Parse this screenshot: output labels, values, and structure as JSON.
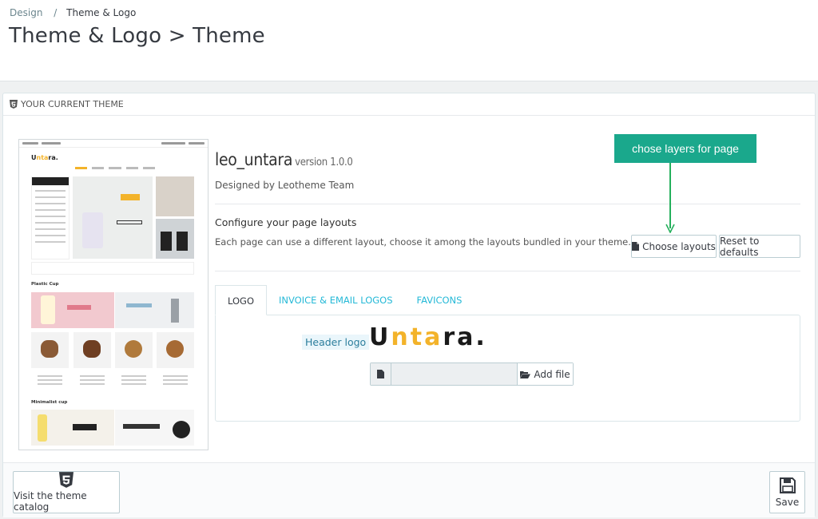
{
  "breadcrumb": {
    "parent": "Design",
    "separator": "/",
    "current": "Theme & Logo"
  },
  "page_title": "Theme & Logo > Theme",
  "panel": {
    "heading": "YOUR CURRENT THEME"
  },
  "theme": {
    "name": "leo_untara",
    "version": "version 1.0.0",
    "designed_by": "Designed by Leotheme Team"
  },
  "layouts": {
    "title": "Configure your page layouts",
    "description": "Each page can use a different layout, choose it among the layouts bundled in your theme.",
    "choose_label": "Choose layouts",
    "reset_label": "Reset to defaults"
  },
  "annotation": {
    "text": "chose layers for page",
    "color": "#1aa88c"
  },
  "tabs": [
    {
      "label": "LOGO",
      "active": true
    },
    {
      "label": "INVOICE & EMAIL LOGOS",
      "active": false
    },
    {
      "label": "FAVICONS",
      "active": false
    }
  ],
  "logo_tab": {
    "header_logo_label": "Header logo",
    "logo_image_text": {
      "part1": "U",
      "part2": "nta",
      "part3": "ra."
    },
    "add_file_label": "Add file"
  },
  "preview": {
    "brand": {
      "part1": "U",
      "part2": "nta",
      "part3": "ra."
    },
    "section1": "Plastic Cup",
    "section2": "Minimalist cup"
  },
  "footer": {
    "catalog_label": "Visit the theme catalog",
    "save_label": "Save"
  },
  "colors": {
    "accent": "#25b9d7",
    "logo_yellow": "#f3b32a",
    "callout": "#1aa88c"
  },
  "icons": [
    "shield-html5-icon",
    "file-icon",
    "folder-open-icon",
    "html5-icon",
    "floppy-disk-icon"
  ]
}
